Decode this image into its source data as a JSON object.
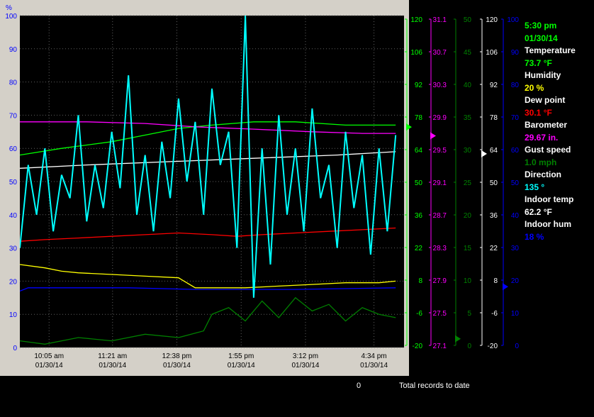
{
  "chart_data": {
    "type": "line",
    "x_tick_labels": [
      {
        "time": "10:05 am",
        "date": "01/30/14"
      },
      {
        "time": "11:21 am",
        "date": "01/30/14"
      },
      {
        "time": "12:38 pm",
        "date": "01/30/14"
      },
      {
        "time": "1:55 pm",
        "date": "01/30/14"
      },
      {
        "time": "3:12 pm",
        "date": "01/30/14"
      },
      {
        "time": "4:34 pm",
        "date": "01/30/14"
      }
    ],
    "x_time_minutes": [
      605,
      681,
      758,
      835,
      912,
      994
    ],
    "x_range_minutes": [
      570,
      1030
    ],
    "left_axis": {
      "unit": "%",
      "ticks": [
        0,
        10,
        20,
        30,
        40,
        50,
        60,
        70,
        80,
        90,
        100
      ],
      "ylim": [
        0,
        100
      ]
    },
    "right_axes": [
      {
        "name": "Temperature",
        "color": "#00ff00",
        "ticks": [
          -20,
          -6,
          8,
          22,
          36,
          50,
          64,
          78,
          92,
          106,
          120
        ],
        "ylim": [
          -20,
          120
        ],
        "marker_value": 73.7
      },
      {
        "name": "Barometer",
        "color": "#ff00ff",
        "ticks": [
          27.1,
          27.5,
          27.9,
          28.3,
          28.7,
          29.1,
          29.5,
          29.9,
          30.3,
          30.7,
          31.1
        ],
        "ylim": [
          27.1,
          31.1
        ],
        "marker_value": 29.67
      },
      {
        "name": "Gust speed",
        "color": "#008000",
        "ticks": [
          0,
          5,
          10,
          15,
          20,
          25,
          30,
          35,
          40,
          45,
          50
        ],
        "ylim": [
          0,
          50
        ],
        "marker_value": 1.0
      },
      {
        "name": "Indoor temp",
        "color": "#ffffff",
        "ticks": [
          -20,
          -6,
          8,
          22,
          36,
          50,
          64,
          78,
          92,
          106,
          120
        ],
        "ylim": [
          -20,
          120
        ],
        "marker_value": 62.2
      },
      {
        "name": "Indoor hum",
        "color": "#0000ff",
        "ticks": [
          0,
          10,
          20,
          30,
          40,
          50,
          60,
          70,
          80,
          90,
          100
        ],
        "ylim": [
          0,
          100
        ],
        "marker_value": 18
      }
    ],
    "series": [
      {
        "name": "Temperature",
        "color": "#00ff00",
        "axis": 0,
        "x": [
          570,
          620,
          680,
          720,
          760,
          800,
          850,
          900,
          960,
          1020
        ],
        "y": [
          58,
          60,
          62,
          64,
          66,
          67,
          68,
          68,
          67,
          67
        ]
      },
      {
        "name": "Barometer",
        "color": "#ff00ff",
        "axis": 1,
        "x": [
          570,
          650,
          720,
          780,
          850,
          920,
          980,
          1020
        ],
        "y": [
          68,
          68,
          67.5,
          66.5,
          65.8,
          65,
          64.5,
          64.5
        ]
      },
      {
        "name": "Indoor temp",
        "color": "#ffffff",
        "axis": 3,
        "x": [
          570,
          650,
          750,
          850,
          950,
          1020
        ],
        "y": [
          54,
          55,
          56,
          57,
          58,
          59
        ]
      },
      {
        "name": "Dew point",
        "color": "#ff0000",
        "axis": 0,
        "x": [
          570,
          600,
          640,
          680,
          720,
          760,
          800,
          830,
          860,
          900,
          940,
          980,
          1020
        ],
        "y": [
          32,
          32.5,
          33,
          33.5,
          34,
          34.5,
          34,
          33.5,
          34,
          34.5,
          35,
          35.5,
          36
        ]
      },
      {
        "name": "Humidity",
        "color": "#ffff00",
        "axis": 0,
        "x": [
          570,
          600,
          620,
          640,
          680,
          720,
          760,
          780,
          800,
          840,
          880,
          920,
          960,
          1000,
          1020
        ],
        "y": [
          25,
          24,
          23,
          22.5,
          22,
          21.5,
          21,
          18,
          18,
          18,
          18.5,
          19,
          19.5,
          19.5,
          20
        ]
      },
      {
        "name": "Indoor hum",
        "color": "#0000ff",
        "axis": 4,
        "x": [
          570,
          580,
          700,
          780,
          900,
          1020
        ],
        "y": [
          17,
          18,
          18,
          17.5,
          17.5,
          18
        ]
      },
      {
        "name": "Direction",
        "color": "#00ffff",
        "axis": 0,
        "x": [
          570,
          580,
          590,
          600,
          610,
          620,
          630,
          640,
          650,
          660,
          670,
          680,
          690,
          700,
          710,
          720,
          730,
          740,
          750,
          760,
          770,
          780,
          790,
          800,
          810,
          820,
          830,
          840,
          850,
          860,
          870,
          880,
          890,
          900,
          910,
          920,
          930,
          940,
          950,
          960,
          970,
          980,
          990,
          1000,
          1010,
          1020
        ],
        "y": [
          30,
          55,
          40,
          60,
          35,
          52,
          45,
          70,
          38,
          55,
          42,
          65,
          48,
          82,
          40,
          58,
          35,
          62,
          45,
          75,
          50,
          68,
          40,
          78,
          55,
          65,
          30,
          100,
          15,
          60,
          25,
          70,
          40,
          60,
          35,
          72,
          45,
          55,
          30,
          65,
          42,
          58,
          28,
          60,
          35,
          64
        ]
      },
      {
        "name": "Gust speed",
        "color": "#008000",
        "axis": 2,
        "x": [
          570,
          600,
          640,
          680,
          720,
          760,
          790,
          800,
          820,
          840,
          860,
          880,
          900,
          920,
          940,
          960,
          980,
          1000,
          1020
        ],
        "y": [
          2,
          1,
          3,
          2,
          4,
          3,
          5,
          10,
          12,
          8,
          14,
          9,
          15,
          11,
          13,
          8,
          12,
          10,
          9
        ]
      }
    ]
  },
  "readout": {
    "time": "5:30 pm",
    "date": "01/30/14",
    "items": [
      {
        "label": "Temperature",
        "value": "73.7 °F",
        "color": "#00ff00"
      },
      {
        "label": "Humidity",
        "value": "20 %",
        "color": "#ffff00"
      },
      {
        "label": "Dew point",
        "value": "30.1 °F",
        "color": "#ff0000"
      },
      {
        "label": "Barometer",
        "value": "29.67 in.",
        "color": "#ff00ff"
      },
      {
        "label": "Gust speed",
        "value": "1.0 mph",
        "color": "#008000"
      },
      {
        "label": "Direction",
        "value": "135 °",
        "color": "#00ffff"
      },
      {
        "label": "Indoor temp",
        "value": "62.2 °F",
        "color": "#ffffff"
      },
      {
        "label": "Indoor hum",
        "value": "18 %",
        "color": "#0000ff"
      }
    ]
  },
  "footer": {
    "count": "0",
    "label": "Total records to date"
  }
}
